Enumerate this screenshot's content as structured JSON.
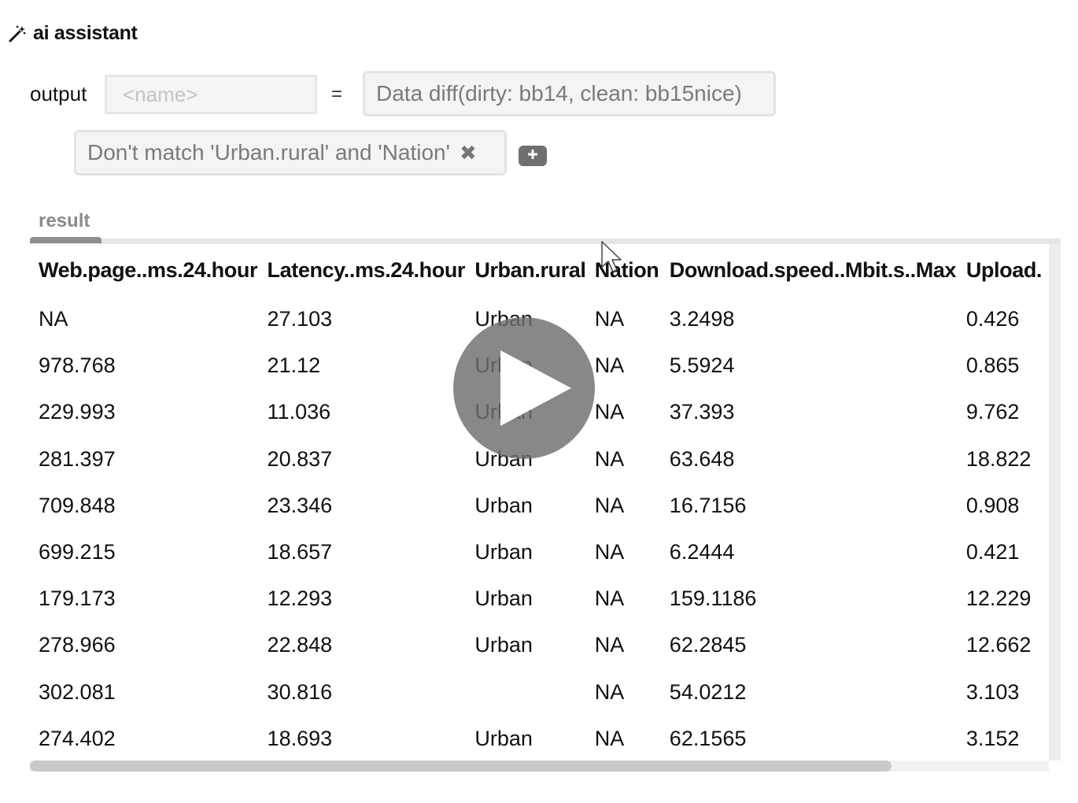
{
  "header": {
    "icon": "magic-wand-icon",
    "title": "ai assistant"
  },
  "output": {
    "label": "output",
    "name_placeholder": "<name>",
    "name_value": "",
    "equals": "=",
    "operation": "Data diff(dirty: bb14, clean: bb15nice)"
  },
  "filters": {
    "chips": [
      {
        "label": "Don't match 'Urban.rural' and 'Nation'",
        "remove_icon": "close-icon",
        "remove_glyph": "✖"
      }
    ],
    "add_icon": "plus-icon"
  },
  "tabs": [
    {
      "label": "result",
      "active": true
    }
  ],
  "table": {
    "columns": [
      "Web.page..ms.24.hour",
      "Latency..ms.24.hour",
      "Urban.rural",
      "Nation",
      "Download.speed..Mbit.s..Max",
      "Upload."
    ],
    "rows": [
      [
        "NA",
        "27.103",
        "Urban",
        "NA",
        "3.2498",
        "0.426"
      ],
      [
        "978.768",
        "21.12",
        "Urban",
        "NA",
        "5.5924",
        "0.865"
      ],
      [
        "229.993",
        "11.036",
        "Urban",
        "NA",
        "37.393",
        "9.762"
      ],
      [
        "281.397",
        "20.837",
        "Urban",
        "NA",
        "63.648",
        "18.822"
      ],
      [
        "709.848",
        "23.346",
        "Urban",
        "NA",
        "16.7156",
        "0.908"
      ],
      [
        "699.215",
        "18.657",
        "Urban",
        "NA",
        "6.2444",
        "0.421"
      ],
      [
        "179.173",
        "12.293",
        "Urban",
        "NA",
        "159.1186",
        "12.229"
      ],
      [
        "278.966",
        "22.848",
        "Urban",
        "NA",
        "62.2845",
        "12.662"
      ],
      [
        "302.081",
        "30.816",
        "",
        "NA",
        "54.0212",
        "3.103"
      ],
      [
        "274.402",
        "18.693",
        "Urban",
        "NA",
        "62.1565",
        "3.152"
      ]
    ]
  },
  "overlay": {
    "icon": "play-icon"
  },
  "colors": {
    "chip_bg": "#f4f4f4",
    "chip_border": "#e3e3e3",
    "muted_text": "#7a7a7a",
    "tab_active": "#8e8e8e",
    "overlay": "#6e6e6e"
  }
}
